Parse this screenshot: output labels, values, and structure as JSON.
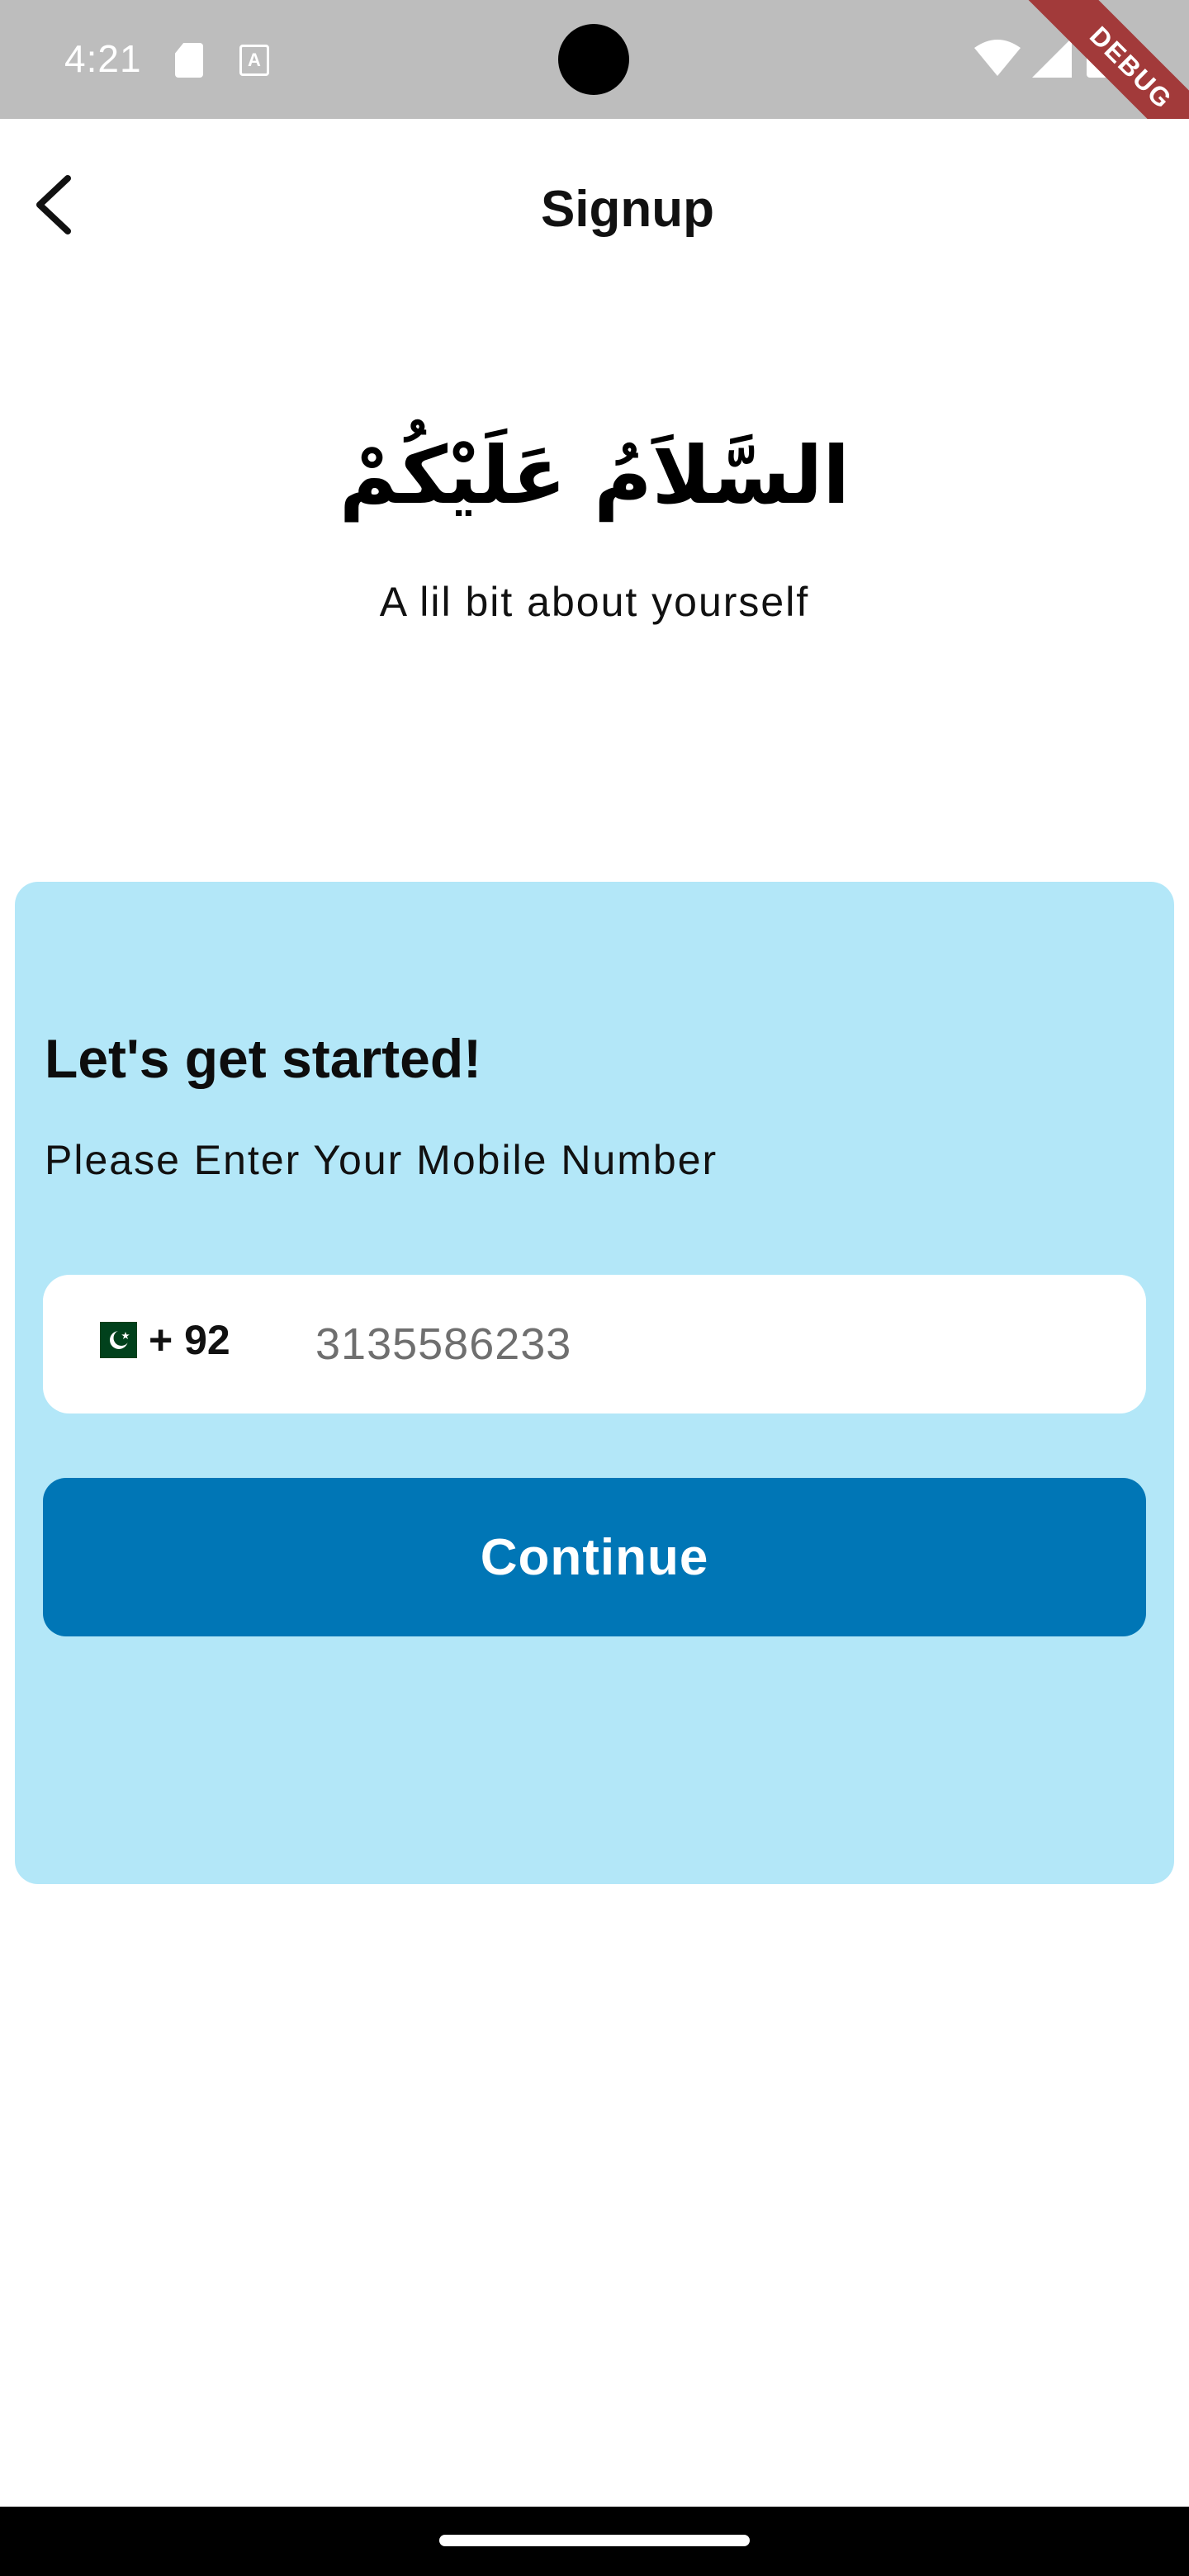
{
  "status_bar": {
    "time": "4:21",
    "debug_label": "DEBUG",
    "a_icon_letter": "A"
  },
  "app_bar": {
    "title": "Signup",
    "back_icon": "chevron-left-icon"
  },
  "greeting": {
    "arabic": "السَّلاَمُ عَلَيْكُمْ",
    "subtitle": "A lil bit about yourself"
  },
  "card": {
    "heading": "Let's get started!",
    "subheading": "Please Enter Your Mobile Number",
    "phone": {
      "flag": "pakistan-flag-icon",
      "dial_code": "+ 92",
      "value": "3135586233"
    },
    "continue_label": "Continue"
  },
  "colors": {
    "card_background": "#b3e7f8",
    "primary_button": "#0076b6",
    "status_bar": "#bdbdbd",
    "debug_ribbon": "#a23a3a"
  }
}
